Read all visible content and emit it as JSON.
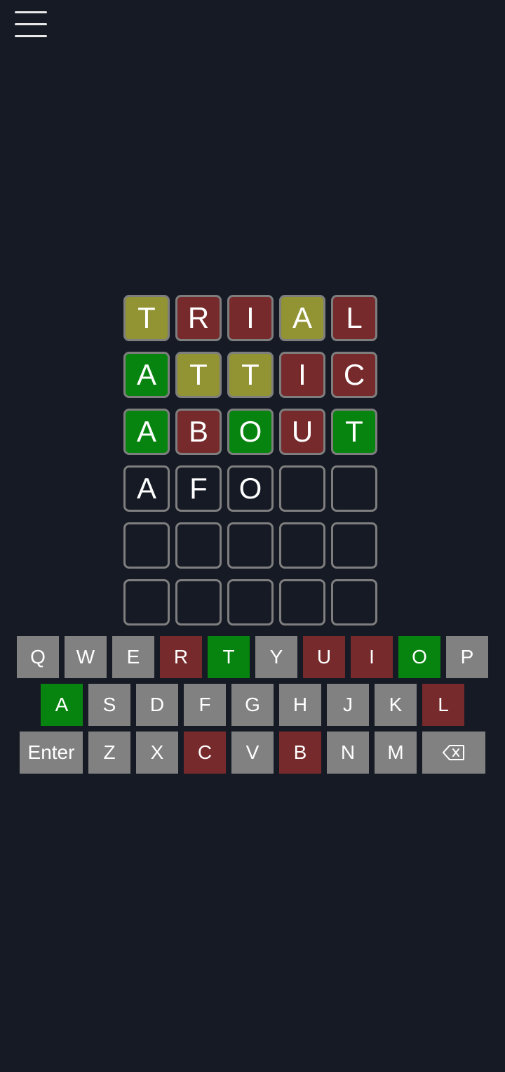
{
  "colors": {
    "background": "#151a24",
    "tile_border": "#7e7e7e",
    "present": "#929333",
    "absent": "#762a2c",
    "correct": "#07840f",
    "key_default": "#818181"
  },
  "header": {
    "menu_icon": "hamburger-menu-icon"
  },
  "board": {
    "rows": [
      [
        {
          "letter": "T",
          "state": "present"
        },
        {
          "letter": "R",
          "state": "absent"
        },
        {
          "letter": "I",
          "state": "absent"
        },
        {
          "letter": "A",
          "state": "present"
        },
        {
          "letter": "L",
          "state": "absent"
        }
      ],
      [
        {
          "letter": "A",
          "state": "correct"
        },
        {
          "letter": "T",
          "state": "present"
        },
        {
          "letter": "T",
          "state": "present"
        },
        {
          "letter": "I",
          "state": "absent"
        },
        {
          "letter": "C",
          "state": "absent"
        }
      ],
      [
        {
          "letter": "A",
          "state": "correct"
        },
        {
          "letter": "B",
          "state": "absent"
        },
        {
          "letter": "O",
          "state": "correct"
        },
        {
          "letter": "U",
          "state": "absent"
        },
        {
          "letter": "T",
          "state": "correct"
        }
      ],
      [
        {
          "letter": "A",
          "state": "empty"
        },
        {
          "letter": "F",
          "state": "empty"
        },
        {
          "letter": "O",
          "state": "empty"
        },
        {
          "letter": "",
          "state": "empty"
        },
        {
          "letter": "",
          "state": "empty"
        }
      ],
      [
        {
          "letter": "",
          "state": "empty"
        },
        {
          "letter": "",
          "state": "empty"
        },
        {
          "letter": "",
          "state": "empty"
        },
        {
          "letter": "",
          "state": "empty"
        },
        {
          "letter": "",
          "state": "empty"
        }
      ],
      [
        {
          "letter": "",
          "state": "empty"
        },
        {
          "letter": "",
          "state": "empty"
        },
        {
          "letter": "",
          "state": "empty"
        },
        {
          "letter": "",
          "state": "empty"
        },
        {
          "letter": "",
          "state": "empty"
        }
      ]
    ]
  },
  "keyboard": {
    "rows": [
      [
        {
          "label": "Q",
          "state": "default"
        },
        {
          "label": "W",
          "state": "default"
        },
        {
          "label": "E",
          "state": "default"
        },
        {
          "label": "R",
          "state": "absent"
        },
        {
          "label": "T",
          "state": "correct"
        },
        {
          "label": "Y",
          "state": "default"
        },
        {
          "label": "U",
          "state": "absent"
        },
        {
          "label": "I",
          "state": "absent"
        },
        {
          "label": "O",
          "state": "correct"
        },
        {
          "label": "P",
          "state": "default"
        }
      ],
      [
        {
          "label": "A",
          "state": "correct"
        },
        {
          "label": "S",
          "state": "default"
        },
        {
          "label": "D",
          "state": "default"
        },
        {
          "label": "F",
          "state": "default"
        },
        {
          "label": "G",
          "state": "default"
        },
        {
          "label": "H",
          "state": "default"
        },
        {
          "label": "J",
          "state": "default"
        },
        {
          "label": "K",
          "state": "default"
        },
        {
          "label": "L",
          "state": "absent"
        }
      ],
      [
        {
          "label": "Enter",
          "state": "default",
          "wide": true
        },
        {
          "label": "Z",
          "state": "default"
        },
        {
          "label": "X",
          "state": "default"
        },
        {
          "label": "C",
          "state": "absent"
        },
        {
          "label": "V",
          "state": "default"
        },
        {
          "label": "B",
          "state": "absent"
        },
        {
          "label": "N",
          "state": "default"
        },
        {
          "label": "M",
          "state": "default"
        },
        {
          "label": "",
          "icon": "backspace-icon",
          "state": "default",
          "wide": true
        }
      ]
    ]
  }
}
